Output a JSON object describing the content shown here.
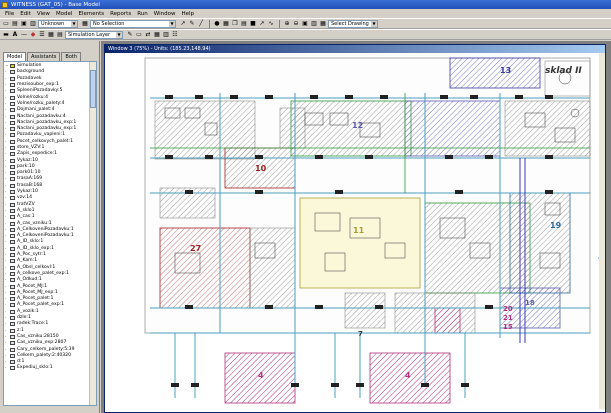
{
  "window": {
    "title": "WITNESS (GAT_05) - Base Model"
  },
  "menu": [
    "File",
    "Edit",
    "View",
    "Model",
    "Elements",
    "Reports",
    "Run",
    "Window",
    "Help"
  ],
  "toolbar": {
    "unknown_combo": "Unknown",
    "selection_combo": "No Selection",
    "layer_combo": "Simulation Layer",
    "drawing_combo": "Select Drawing"
  },
  "panel": {
    "tabs": [
      "Model",
      "Assistants",
      "Both"
    ],
    "tree": [
      "Simulation",
      "background",
      "Pozadavek",
      "mezisoubor_exp:1",
      "SpleeniPozadavky:5",
      "Volne/rozku:4",
      "Volne/rozku_palety:4",
      "Dojmani_palet:4",
      "Naclani_pozadavku:4",
      "Naclani_pozadavku_exp:1",
      "Naclani_pozadavku_exp:1",
      "Pozadavku_vapleni:1",
      "Pocet_celkovych_palet:1",
      "store_VZV:1",
      "Zapis_expedice:1",
      "Vykaz:10",
      "park:10",
      "park01:10",
      "trasaA:169",
      "trasaB:168",
      "Vykaz:10",
      "vzv:14",
      "tratVZV",
      "A_sklo1",
      "A_cas:1",
      "A_cas_vzniku:1",
      "A_CelkoveniPozadavku:1",
      "A_CelkoveniPozadavku:1",
      "A_ID_sklo:1",
      "A_ID_sklo_exp:1",
      "A_Poc_sytr:1",
      "A_Kam:1",
      "A_Obsl_celkovl:1",
      "A_celkove_palet_exp:1",
      "A_Odkud:1",
      "A_Pocet_MJ:1",
      "A_Pocet_MJ_exp:1",
      "A_Pocet_palet:1",
      "A_Pocet_palet_exp:1",
      "A_vozik:1",
      "dzle:1",
      "radek:Trace:1",
      "z:1",
      "Cas_vzniku:28150",
      "Cas_vzniku_exp:2807",
      "Cary_celkem_palety:5:39",
      "Celkem_palety:2:40320",
      "d:1",
      "Expediuj_sklo:1"
    ]
  },
  "document": {
    "title": "Window 3 (75%) - Units: (185.23,148.94)",
    "label_sklad": "sklad II",
    "zones": [
      {
        "label": "13",
        "color": "#3a3aa0"
      },
      {
        "label": "12",
        "color": "#5a5ab0"
      },
      {
        "label": "10",
        "color": "#a02020"
      },
      {
        "label": "11",
        "color": "#a8a030"
      },
      {
        "label": "19",
        "color": "#2a6aa0"
      },
      {
        "label": "27",
        "color": "#a02020"
      },
      {
        "label": "18",
        "color": "#5a5ab0"
      },
      {
        "label": "20",
        "color": "#b03080"
      },
      {
        "label": "21",
        "color": "#b03080"
      },
      {
        "label": "15",
        "color": "#b03080"
      },
      {
        "label": "7",
        "color": "#3a3a3a"
      },
      {
        "label": "4",
        "color": "#b03080"
      },
      {
        "label": "4",
        "color": "#b03080"
      }
    ]
  }
}
